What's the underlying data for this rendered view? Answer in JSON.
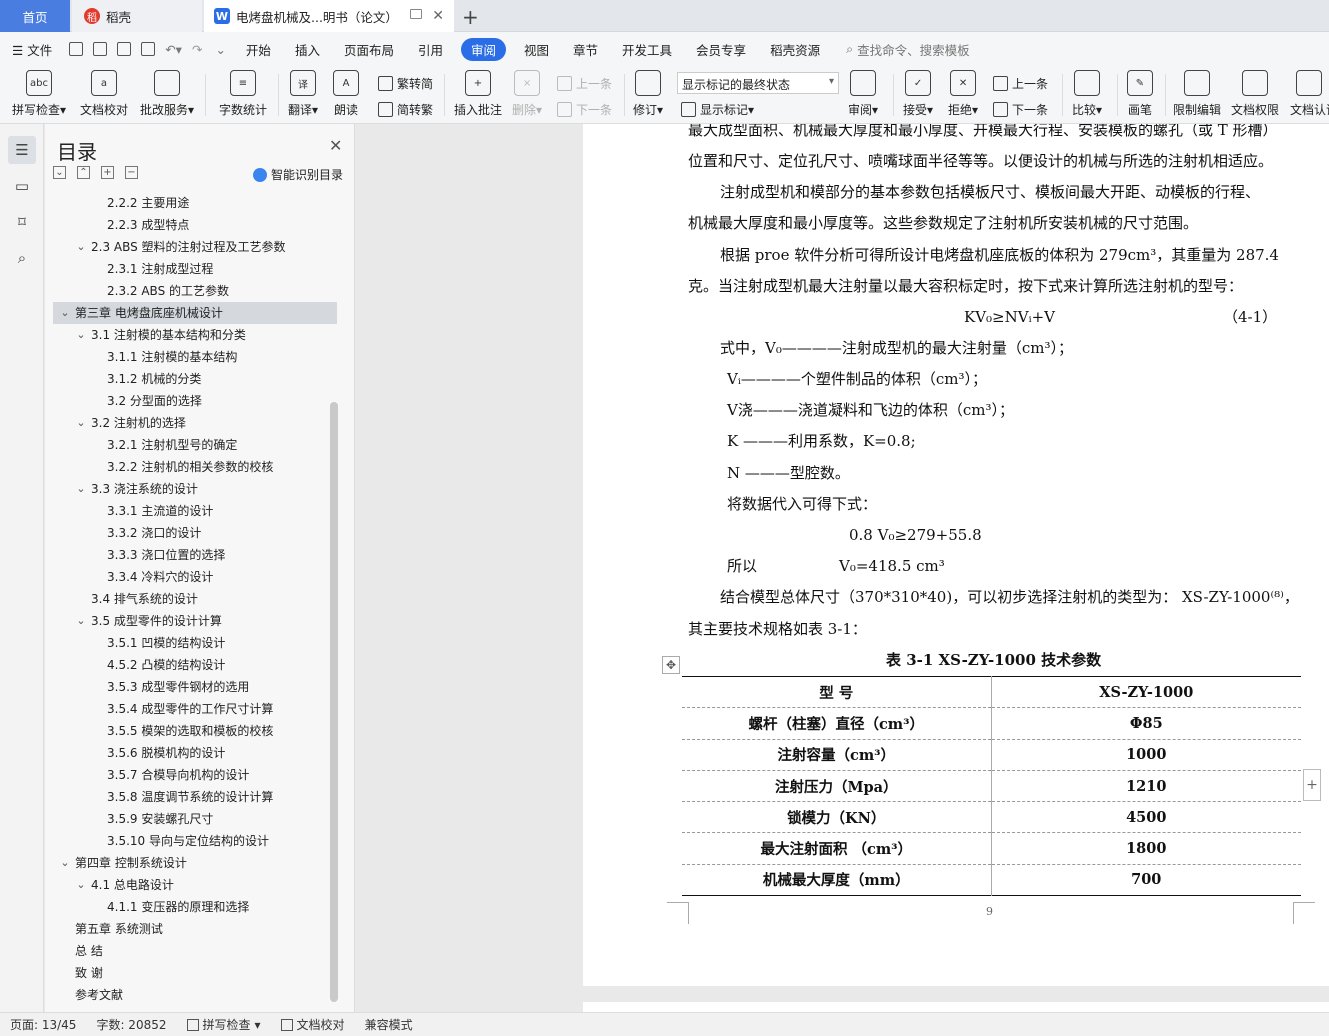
{
  "tabs": {
    "home": "首页",
    "daoke": "稻壳",
    "doc": "电烤盘机械及...明书（论文）",
    "new_tab": "+"
  },
  "menu": {
    "file": "文件",
    "items": [
      "开始",
      "插入",
      "页面布局",
      "引用",
      "审阅",
      "视图",
      "章节",
      "开发工具",
      "会员专享",
      "稻壳资源"
    ],
    "active": "审阅",
    "search": "查找命令、搜索模板"
  },
  "ribbon": {
    "spell": "拼写检查",
    "doc_check": "文档校对",
    "batch": "批改服务",
    "word_count": "字数统计",
    "translate": "翻译",
    "read": "朗读",
    "trad_to_simp": "繁转简",
    "simp_to_trad": "简转繁",
    "insert_comment": "插入批注",
    "delete": "删除",
    "prev_comment": "上一条",
    "next_comment": "下一条",
    "track": "修订",
    "markup_mode": "显示标记的最终状态",
    "show_markup": "显示标记",
    "review": "审阅",
    "accept": "接受",
    "reject": "拒绝",
    "prev_change": "上一条",
    "next_change": "下一条",
    "compare": "比较",
    "pen": "画笔",
    "restrict": "限制编辑",
    "permission": "文档权限",
    "cert": "文档认证"
  },
  "toc": {
    "title": "目录",
    "ai": "智能识别目录",
    "items": [
      {
        "text": "2.2.2  主要用途",
        "level": 3
      },
      {
        "text": "2.2.3  成型特点",
        "level": 3
      },
      {
        "text": "2.3 ABS 塑料的注射过程及工艺参数",
        "level": 2,
        "expanded": true
      },
      {
        "text": "2.3.1  注射成型过程",
        "level": 3
      },
      {
        "text": "2.3.2 ABS 的工艺参数",
        "level": 3
      },
      {
        "text": "第三章  电烤盘底座机械设计",
        "level": 1,
        "expanded": true,
        "selected": true
      },
      {
        "text": "3.1 注射模的基本结构和分类",
        "level": 2,
        "expanded": true
      },
      {
        "text": "3.1.1 注射模的基本结构",
        "level": 3
      },
      {
        "text": "3.1.2 机械的分类",
        "level": 3
      },
      {
        "text": "3.2 分型面的选择",
        "level": 3
      },
      {
        "text": "3.2 注射机的选择",
        "level": 2,
        "expanded": true
      },
      {
        "text": "3.2.1 注射机型号的确定",
        "level": 3
      },
      {
        "text": "3.2.2 注射机的相关参数的校核",
        "level": 3
      },
      {
        "text": "3.3 浇注系统的设计",
        "level": 2,
        "expanded": true
      },
      {
        "text": "3.3.1  主流道的设计",
        "level": 3
      },
      {
        "text": "3.3.2  浇口的设计",
        "level": 3
      },
      {
        "text": "3.3.3  浇口位置的选择",
        "level": 3
      },
      {
        "text": "3.3.4  冷料穴的设计",
        "level": 3
      },
      {
        "text": "3.4  排气系统的设计",
        "level": 2
      },
      {
        "text": "3.5  成型零件的设计计算",
        "level": 2,
        "expanded": true
      },
      {
        "text": "3.5.1 凹模的结构设计",
        "level": 3
      },
      {
        "text": "4.5.2  凸模的结构设计",
        "level": 3
      },
      {
        "text": "3.5.3  成型零件钢材的选用",
        "level": 3
      },
      {
        "text": "3.5.4  成型零件的工作尺寸计算",
        "level": 3
      },
      {
        "text": "3.5.5  模架的选取和模板的校核",
        "level": 3
      },
      {
        "text": "3.5.6  脱模机构的设计",
        "level": 3
      },
      {
        "text": "3.5.7 合模导向机构的设计",
        "level": 3
      },
      {
        "text": "3.5.8  温度调节系统的设计计算",
        "level": 3
      },
      {
        "text": "3.5.9  安装螺孔尺寸",
        "level": 3
      },
      {
        "text": "3.5.10  导向与定位结构的设计",
        "level": 3
      },
      {
        "text": "第四章  控制系统设计",
        "level": 1,
        "expanded": true
      },
      {
        "text": "4.1 总电路设计",
        "level": 2,
        "expanded": true
      },
      {
        "text": "4.1.1 变压器的原理和选择",
        "level": 3
      },
      {
        "text": "第五章  系统测试",
        "level": 1
      },
      {
        "text": "总    结",
        "level": 1
      },
      {
        "text": "致    谢",
        "level": 1
      },
      {
        "text": "参考文献",
        "level": 1
      }
    ]
  },
  "doc": {
    "lines": [
      "最大成型面积、机械最大厚度和最小厚度、开模最大行程、安装模板的螺孔（或 T 形槽）",
      "位置和尺寸、定位孔尺寸、喷嘴球面半径等等。以便设计的机械与所选的注射机相适应。",
      "注射成型机和模部分的基本参数包括模板尺寸、模板间最大开距、动模板的行程、",
      "机械最大厚度和最小厚度等。这些参数规定了注射机所安装机械的尺寸范围。",
      "根据 proe 软件分析可得所设计电烤盘机座底板的体积为 279cm³，其重量为 287.4",
      "克。当注射成型机最大注射量以最大容积标定时，按下式来计算所选注射机的型号：",
      "KV₀≥NVᵢ+V",
      "（4-1）",
      "式中，V₀————注射成型机的最大注射量（cm³）；",
      "Vᵢ————个塑件制品的体积（cm³）；",
      "V浇———浇道凝料和飞边的体积（cm³）；",
      "K ———利用系数，K=0.8;",
      "N ———型腔数。",
      "将数据代入可得下式：",
      "0.8 V₀≥279+55.8",
      "所以",
      "V₀=418.5 cm³",
      "结合模型总体尺寸（370*310*40)，可以初步选择注射机的类型为： XS-ZY-1000⁽⁸⁾，",
      "其主要技术规格如表 3-1："
    ],
    "table_caption": "表 3-1    XS-ZY-1000 技术参数",
    "table": [
      [
        "型         号",
        "XS-ZY-1000"
      ],
      [
        "螺杆（柱塞）直径（cm³）",
        "Φ85"
      ],
      [
        "注射容量（cm³）",
        "1000"
      ],
      [
        "注射压力（Mpa）",
        "1210"
      ],
      [
        "锁模力（KN）",
        "4500"
      ],
      [
        "最大注射面积  （cm³）",
        "1800"
      ],
      [
        "机械最大厚度（mm）",
        "700"
      ]
    ],
    "page_number": "9"
  },
  "status": {
    "page": "页面: 13/45",
    "words": "字数: 20852",
    "spell": "拼写检查",
    "doc_check": "文档校对",
    "compat": "兼容模式"
  }
}
